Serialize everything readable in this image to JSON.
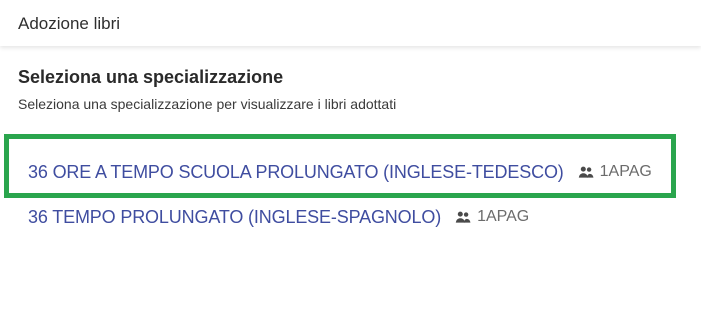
{
  "header": {
    "title": "Adozione libri"
  },
  "section": {
    "title": "Seleziona una specializzazione",
    "subtitle": "Seleziona una specializzazione per visualizzare i libri adottati"
  },
  "specializations": [
    {
      "name": "36 ORE A TEMPO SCUOLA PROLUNGATO (INGLESE-TEDESCO)",
      "icon": "group-icon",
      "class_code": "1APAG"
    },
    {
      "name": "36 TEMPO PROLUNGATO (INGLESE-SPAGNOLO)",
      "icon": "group-icon",
      "class_code": "1APAG"
    }
  ],
  "colors": {
    "link": "#3f4da0",
    "highlight": "#2aa54d",
    "muted": "#6b6b6b"
  }
}
